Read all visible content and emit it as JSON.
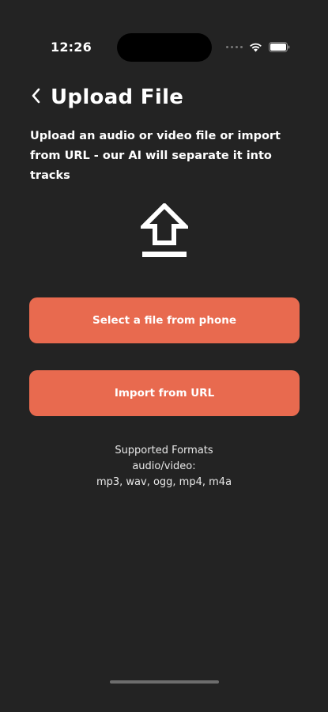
{
  "status_bar": {
    "time": "12:26"
  },
  "header": {
    "title": "Upload File",
    "back_icon": "chevron-left-icon"
  },
  "subtitle": "Upload an audio or video file or import from URL - our AI will separate it into tracks",
  "icons": {
    "upload": "upload-arrow-icon",
    "wifi": "wifi-icon",
    "battery": "battery-icon"
  },
  "buttons": {
    "select_file": "Select a file from phone",
    "import_url": "Import from URL"
  },
  "formats": {
    "title": "Supported Formats",
    "category": "audio/video:",
    "list": "mp3, wav, ogg, mp4, m4a"
  },
  "colors": {
    "background": "#232323",
    "accent": "#e86a4f",
    "text": "#ffffff"
  }
}
